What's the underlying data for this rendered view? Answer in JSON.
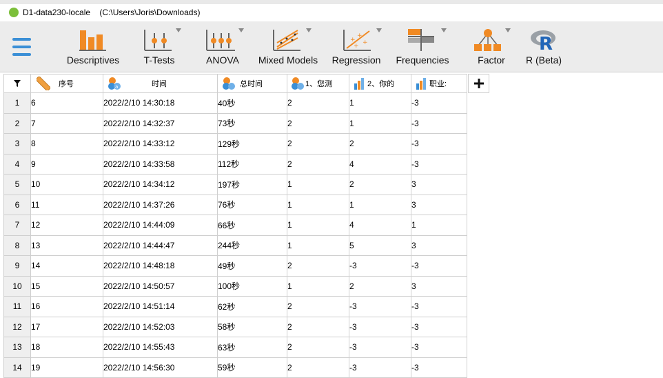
{
  "window": {
    "title": "D1-data230-locale",
    "path": "(C:\\Users\\Joris\\Downloads)"
  },
  "ribbon": {
    "tools": [
      {
        "label": "Descriptives",
        "icon": "descriptives-icon"
      },
      {
        "label": "T-Tests",
        "icon": "t-tests-icon"
      },
      {
        "label": "ANOVA",
        "icon": "anova-icon"
      },
      {
        "label": "Mixed Models",
        "icon": "mixed-models-icon"
      },
      {
        "label": "Regression",
        "icon": "regression-icon"
      },
      {
        "label": "Frequencies",
        "icon": "frequencies-icon"
      },
      {
        "label": "Factor",
        "icon": "factor-icon"
      },
      {
        "label": "R (Beta)",
        "icon": "r-icon"
      }
    ]
  },
  "columns": [
    {
      "label": "序号",
      "icon": "ruler-icon"
    },
    {
      "label": "时间",
      "icon": "nominal-text-icon"
    },
    {
      "label": "总时间",
      "icon": "nominal-icon"
    },
    {
      "label": "1、您测",
      "icon": "nominal-icon"
    },
    {
      "label": "2、你的",
      "icon": "ordinal-bar-icon"
    },
    {
      "label": "职业:",
      "icon": "ordinal-bar-icon"
    }
  ],
  "rows": [
    [
      "1",
      "6",
      "2022/2/10 14:30:18",
      "40秒",
      "2",
      "1",
      "-3"
    ],
    [
      "2",
      "7",
      "2022/2/10 14:32:37",
      "73秒",
      "2",
      "1",
      "-3"
    ],
    [
      "3",
      "8",
      "2022/2/10 14:33:12",
      "129秒",
      "2",
      "2",
      "-3"
    ],
    [
      "4",
      "9",
      "2022/2/10 14:33:58",
      "112秒",
      "2",
      "4",
      "-3"
    ],
    [
      "5",
      "10",
      "2022/2/10 14:34:12",
      "197秒",
      "1",
      "2",
      "3"
    ],
    [
      "6",
      "11",
      "2022/2/10 14:37:26",
      "76秒",
      "1",
      "1",
      "3"
    ],
    [
      "7",
      "12",
      "2022/2/10 14:44:09",
      "66秒",
      "1",
      "4",
      "1"
    ],
    [
      "8",
      "13",
      "2022/2/10 14:44:47",
      "244秒",
      "1",
      "5",
      "3"
    ],
    [
      "9",
      "14",
      "2022/2/10 14:48:18",
      "49秒",
      "2",
      "-3",
      "-3"
    ],
    [
      "10",
      "15",
      "2022/2/10 14:50:57",
      "100秒",
      "1",
      "2",
      "3"
    ],
    [
      "11",
      "16",
      "2022/2/10 14:51:14",
      "62秒",
      "2",
      "-3",
      "-3"
    ],
    [
      "12",
      "17",
      "2022/2/10 14:52:03",
      "58秒",
      "2",
      "-3",
      "-3"
    ],
    [
      "13",
      "18",
      "2022/2/10 14:55:43",
      "63秒",
      "2",
      "-3",
      "-3"
    ],
    [
      "14",
      "19",
      "2022/2/10 14:56:30",
      "59秒",
      "2",
      "-3",
      "-3"
    ]
  ],
  "colors": {
    "accent_blue": "#3b8fd6",
    "bar_orange": "#f08a24",
    "header_bg": "#ececec"
  }
}
